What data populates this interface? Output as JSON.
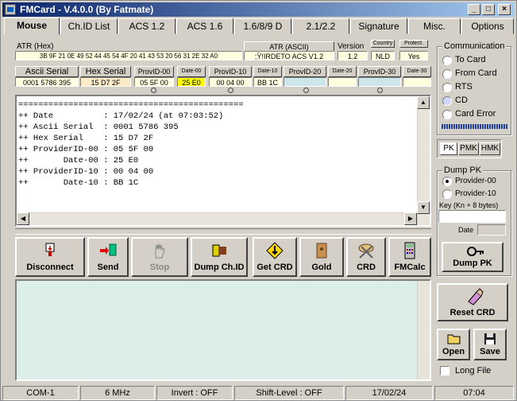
{
  "window": {
    "title": "FMCard - V.4.0.0 (By Fatmate)"
  },
  "tabs": [
    "Mouse",
    "Ch.ID List",
    "ACS 1.2",
    "ACS 1.6",
    "1.6/8/9 D",
    "2.1/2.2",
    "Signature",
    "Misc.",
    "Options"
  ],
  "atr": {
    "hex_label": "ATR (Hex)",
    "hex_value": "3B 9F 21 0E 49 52 44 45 54 4F 20 41 43 53 20 56 31 2E 32 A0",
    "ascii_label": "ATR (ASCII)",
    "ascii_value": ";Ÿ!IRDETO ACS V1.2",
    "version_label": "Version",
    "version_value": "1.2",
    "field5_label": "Country",
    "field5_value": "NLD",
    "field6_label": "Protect.",
    "field6_value": "Yes"
  },
  "card": {
    "headers": [
      "Ascii Serial",
      "Hex Serial",
      "ProvID-00",
      "Date-00",
      "ProvID-10",
      "Date-10",
      "ProvID-20",
      "Date-20",
      "ProvID-30",
      "Date-30"
    ],
    "values": [
      "0001 5786 395",
      "15 D7 2F",
      "05 5F 00",
      "25 E0",
      "00 04 00",
      "BB 1C",
      "",
      "",
      "",
      ""
    ]
  },
  "console_lines": [
    "=============================================",
    "++ Date          : 17/02/24 (at 07:03:52)",
    "++ Ascii Serial  : 0001 5786 395",
    "++ Hex Serial    : 15 D7 2F",
    "++ ProviderID-00 : 05 5F 00",
    "++       Date-00 : 25 E0",
    "++ ProviderID-10 : 00 04 00",
    "++       Date-10 : BB 1C"
  ],
  "buttons": {
    "disconnect": "Disconnect",
    "send": "Send",
    "stop": "Stop",
    "dump_chid": "Dump Ch.ID",
    "get_crd": "Get CRD",
    "gold": "Gold",
    "crd": "CRD",
    "fmcalc": "FMCalc"
  },
  "communication": {
    "title": "Communication",
    "items": [
      "To Card",
      "From Card",
      "RTS",
      "CD",
      "Card Error"
    ]
  },
  "keys": {
    "pk": "PK",
    "pmk": "PMK",
    "hmk": "HMK"
  },
  "dump_pk": {
    "title": "Dump PK",
    "options": [
      "Provider-00",
      "Provider-10"
    ],
    "key_label": "Key (Kn + 8 bytes)",
    "key_value": "",
    "date_label": "Date",
    "date_value": "",
    "button": "Dump PK"
  },
  "right_buttons": {
    "reset_crd": "Reset CRD",
    "open": "Open",
    "save": "Save",
    "long_file": "Long File"
  },
  "status": [
    "COM-1",
    "6 MHz",
    "Invert : OFF",
    "Shift-Level : OFF",
    "17/02/24",
    "07:04"
  ],
  "colors": {
    "title_bar": "#0a246a",
    "field_bg": "#ffffe0",
    "highlight": "#ffff00",
    "log_bg": "#dbeeea",
    "cell_empty": "#cce6ea"
  }
}
